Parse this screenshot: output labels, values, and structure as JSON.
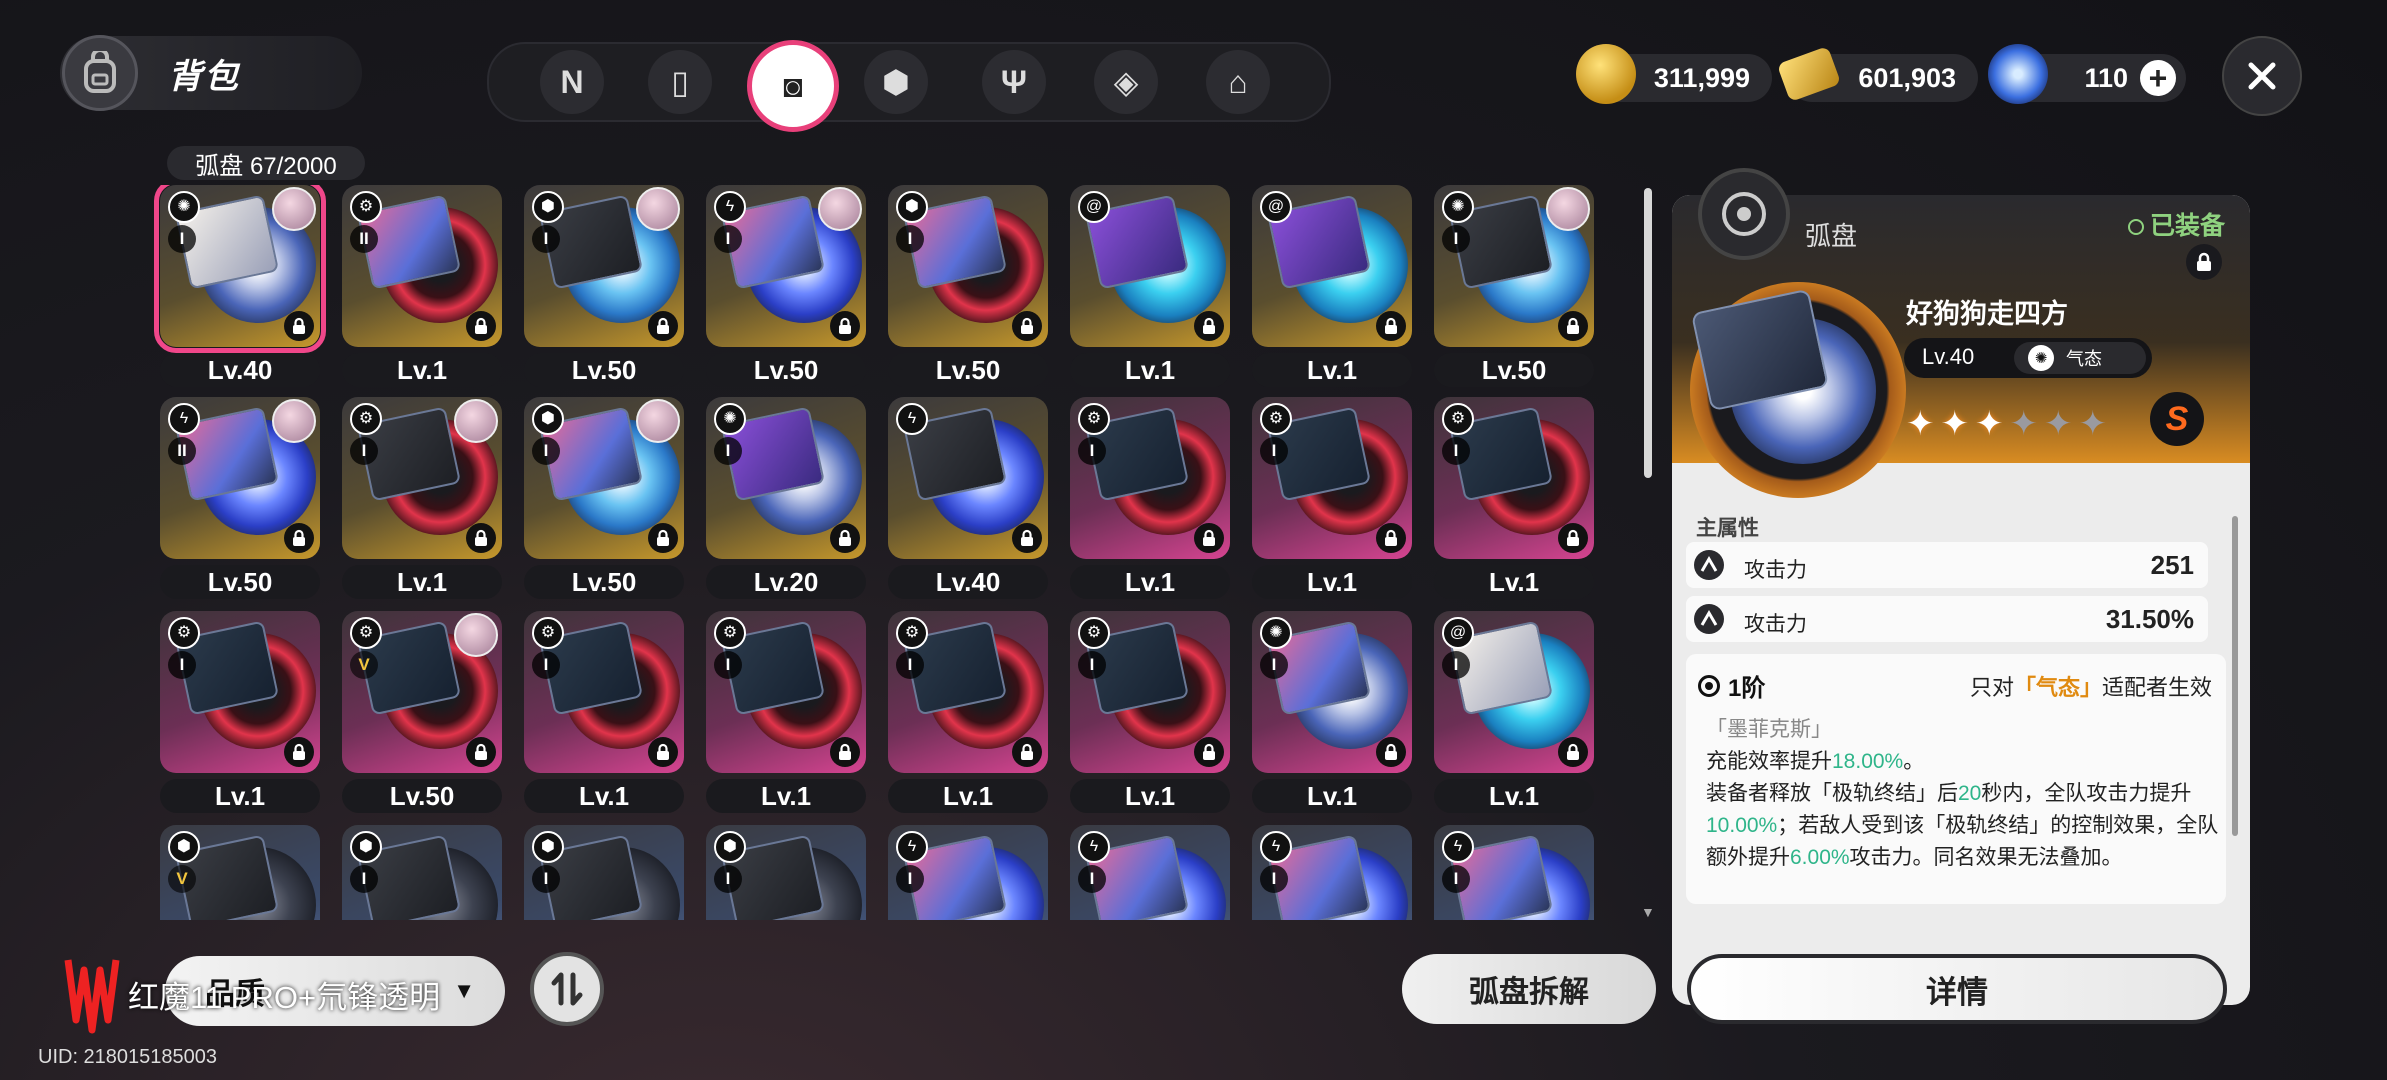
{
  "header": {
    "bag_title": "背包",
    "tabs": [
      {
        "name": "tab-n-icon",
        "glyph": "N"
      },
      {
        "name": "tab-gameboy-icon",
        "glyph": "▯"
      },
      {
        "name": "tab-disc-icon",
        "glyph": "◙"
      },
      {
        "name": "tab-cube-icon",
        "glyph": "⬢"
      },
      {
        "name": "tab-food-icon",
        "glyph": "Ψ"
      },
      {
        "name": "tab-box-icon",
        "glyph": "◈"
      },
      {
        "name": "tab-home-icon",
        "glyph": "⌂"
      }
    ],
    "active_tab": 2,
    "resources": {
      "gold": "311,999",
      "ticket": "601,903",
      "crystal": "110"
    }
  },
  "inventory": {
    "count_label": "弧盘 67/2000",
    "colors": {
      "gold": "#c6982c",
      "pink": "#d64491",
      "blue": "#5b6a90",
      "select": "#f0478a"
    },
    "cards": [
      {
        "bg": "g",
        "disc": "d-wave",
        "cover": "t-wh",
        "attr": "wind",
        "rank": "I",
        "lvl": "Lv.40",
        "avatar": true,
        "selected": true
      },
      {
        "bg": "g",
        "disc": "d-red",
        "cover": "t-col",
        "attr": "gear",
        "rank": "II",
        "lvl": "Lv.1",
        "avatar": false
      },
      {
        "bg": "g",
        "disc": "d-ice",
        "cover": "t-dk",
        "attr": "dice",
        "rank": "I",
        "lvl": "Lv.50",
        "avatar": true
      },
      {
        "bg": "g",
        "disc": "d-elec",
        "cover": "t-col",
        "attr": "bolt",
        "rank": "I",
        "lvl": "Lv.50",
        "avatar": true
      },
      {
        "bg": "g",
        "disc": "d-red",
        "cover": "t-col",
        "attr": "dice",
        "rank": "I",
        "lvl": "Lv.50",
        "avatar": false
      },
      {
        "bg": "g",
        "disc": "d-aqua",
        "cover": "t-pur",
        "attr": "swirl",
        "rank": "",
        "lvl": "Lv.1",
        "avatar": false
      },
      {
        "bg": "g",
        "disc": "d-aqua",
        "cover": "t-pur",
        "attr": "swirl",
        "rank": "",
        "lvl": "Lv.1",
        "avatar": false
      },
      {
        "bg": "g",
        "disc": "d-ice",
        "cover": "t-dk",
        "attr": "wind",
        "rank": "I",
        "lvl": "Lv.50",
        "avatar": true
      },
      {
        "bg": "g",
        "disc": "d-elec",
        "cover": "t-col",
        "attr": "bolt",
        "rank": "II",
        "lvl": "Lv.50",
        "avatar": true
      },
      {
        "bg": "g",
        "disc": "d-red",
        "cover": "t-dk",
        "attr": "gear",
        "rank": "I",
        "lvl": "Lv.1",
        "avatar": true
      },
      {
        "bg": "g",
        "disc": "d-ice",
        "cover": "t-col",
        "attr": "dice",
        "rank": "I",
        "lvl": "Lv.50",
        "avatar": true
      },
      {
        "bg": "g",
        "disc": "d-wave",
        "cover": "t-pur",
        "attr": "wind",
        "rank": "I",
        "lvl": "Lv.20",
        "avatar": false
      },
      {
        "bg": "g",
        "disc": "d-elec",
        "cover": "t-dk",
        "attr": "bolt",
        "rank": "",
        "lvl": "Lv.40",
        "avatar": false
      },
      {
        "bg": "p",
        "disc": "d-red",
        "cover": "t-gm",
        "attr": "gear",
        "rank": "I",
        "lvl": "Lv.1",
        "avatar": false
      },
      {
        "bg": "p",
        "disc": "d-red",
        "cover": "t-gm",
        "attr": "gear",
        "rank": "I",
        "lvl": "Lv.1",
        "avatar": false
      },
      {
        "bg": "p",
        "disc": "d-red",
        "cover": "t-gm",
        "attr": "gear",
        "rank": "I",
        "lvl": "Lv.1",
        "avatar": false
      },
      {
        "bg": "p",
        "disc": "d-red",
        "cover": "t-gm",
        "attr": "gear",
        "rank": "I",
        "lvl": "Lv.1",
        "avatar": false
      },
      {
        "bg": "p",
        "disc": "d-red",
        "cover": "t-gm",
        "attr": "gear",
        "rank": "V",
        "lvl": "Lv.50",
        "avatar": true
      },
      {
        "bg": "p",
        "disc": "d-red",
        "cover": "t-gm",
        "attr": "gear",
        "rank": "I",
        "lvl": "Lv.1",
        "avatar": false
      },
      {
        "bg": "p",
        "disc": "d-red",
        "cover": "t-gm",
        "attr": "gear",
        "rank": "I",
        "lvl": "Lv.1",
        "avatar": false
      },
      {
        "bg": "p",
        "disc": "d-red",
        "cover": "t-gm",
        "attr": "gear",
        "rank": "I",
        "lvl": "Lv.1",
        "avatar": false
      },
      {
        "bg": "p",
        "disc": "d-red",
        "cover": "t-gm",
        "attr": "gear",
        "rank": "I",
        "lvl": "Lv.1",
        "avatar": false
      },
      {
        "bg": "p",
        "disc": "d-wave",
        "cover": "t-col",
        "attr": "wind",
        "rank": "I",
        "lvl": "Lv.1",
        "avatar": false
      },
      {
        "bg": "p",
        "disc": "d-aqua",
        "cover": "t-wh",
        "attr": "swirl",
        "rank": "I",
        "lvl": "Lv.1",
        "avatar": false
      },
      {
        "bg": "b",
        "disc": "d-dark",
        "cover": "t-dk",
        "attr": "dice",
        "rank": "V",
        "lvl": "",
        "avatar": false
      },
      {
        "bg": "b",
        "disc": "d-dark",
        "cover": "t-dk",
        "attr": "dice",
        "rank": "I",
        "lvl": "",
        "avatar": false
      },
      {
        "bg": "b",
        "disc": "d-dark",
        "cover": "t-dk",
        "attr": "dice",
        "rank": "I",
        "lvl": "",
        "avatar": false
      },
      {
        "bg": "b",
        "disc": "d-dark",
        "cover": "t-dk",
        "attr": "dice",
        "rank": "I",
        "lvl": "",
        "avatar": false
      },
      {
        "bg": "b",
        "disc": "d-elec",
        "cover": "t-col",
        "attr": "bolt",
        "rank": "I",
        "lvl": "",
        "avatar": false
      },
      {
        "bg": "b",
        "disc": "d-elec",
        "cover": "t-col",
        "attr": "bolt",
        "rank": "I",
        "lvl": "",
        "avatar": false
      },
      {
        "bg": "b",
        "disc": "d-elec",
        "cover": "t-col",
        "attr": "bolt",
        "rank": "I",
        "lvl": "",
        "avatar": false
      },
      {
        "bg": "b",
        "disc": "d-elec",
        "cover": "t-col",
        "attr": "bolt",
        "rank": "I",
        "lvl": "",
        "avatar": false
      }
    ]
  },
  "bottom": {
    "filter_label": "品质",
    "watermark_text": "红魔11 PRO+氘锋透明",
    "uid": "UID: 218015185003",
    "dismantle_label": "弧盘拆解"
  },
  "detail": {
    "title": "弧盘",
    "equipped": "已装备",
    "name": "好狗狗走四方",
    "level": "Lv.40",
    "attribute": "气态",
    "stars_filled": 3,
    "stars_total": 6,
    "rank_badge": "S",
    "main_header": "主属性",
    "stats": [
      {
        "name": "攻击力",
        "value": "251"
      },
      {
        "name": "攻击力",
        "value": "31.50%"
      }
    ],
    "tier": "1阶",
    "only_for_pre": "只对",
    "only_for_attr": "「气态」",
    "only_for_post": "适配者生效",
    "effect_sub": "「墨菲克斯」",
    "effect_line1_a": "充能效率提升",
    "effect_line1_num": "18.00%",
    "effect_line1_b": "。",
    "effect_line2_a": "装备者释放「极轨终结」后",
    "effect_line2_num1": "20",
    "effect_line2_b": "秒内，全队攻击力提升",
    "effect_line2_num2": "10.00%",
    "effect_line2_c": "；若敌人受到该「极轨终结」的控制效果，全队额外提升",
    "effect_line2_num3": "6.00%",
    "effect_line2_d": "攻击力。同名效果无法叠加。",
    "details_label": "详情"
  }
}
